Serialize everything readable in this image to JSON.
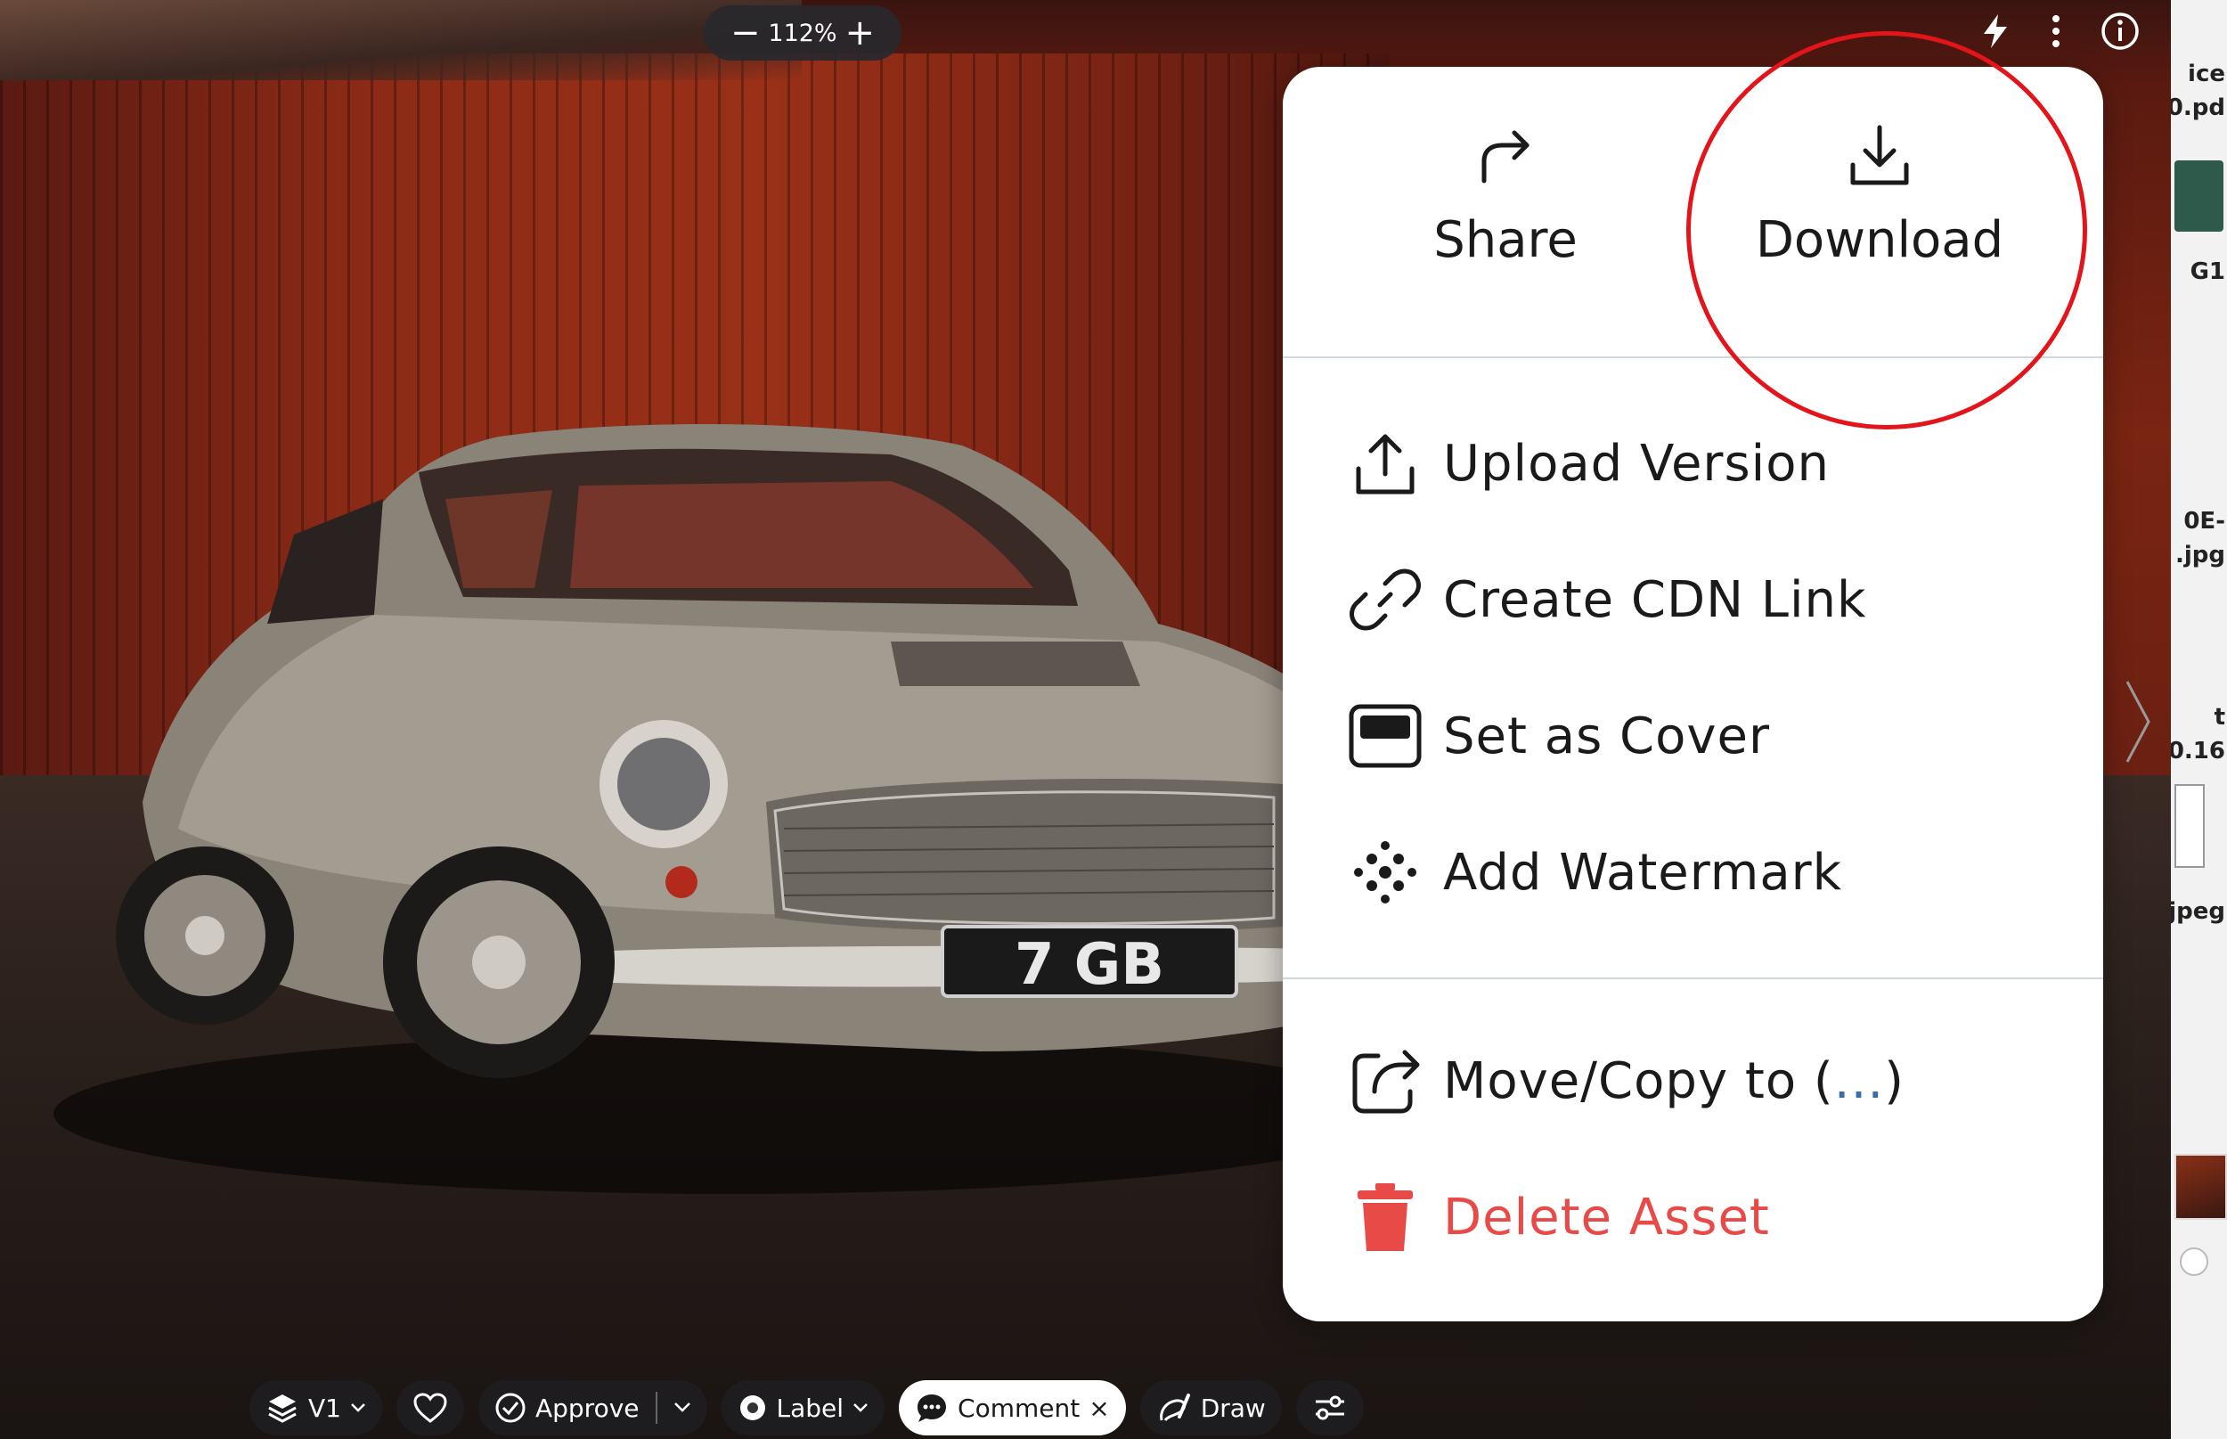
{
  "viewer": {
    "zoom": {
      "minus": "−",
      "level": "112%",
      "plus": "+"
    },
    "plate_text": "7 GB"
  },
  "top_icons": [
    "bolt-icon",
    "more-vertical-icon",
    "info-icon"
  ],
  "file_panel": {
    "labels": [
      "ice",
      "0.pd",
      "G1",
      "0E-",
      ".jpg",
      "t",
      "0.16",
      "jpeg"
    ]
  },
  "menu": {
    "share_label": "Share",
    "download_label": "Download",
    "items": [
      {
        "label": "Upload Version",
        "icon": "upload-icon"
      },
      {
        "label": "Create CDN Link",
        "icon": "link-icon"
      },
      {
        "label": "Set as Cover",
        "icon": "cover-icon"
      },
      {
        "label": "Add Watermark",
        "icon": "watermark-icon"
      }
    ],
    "move_label": "Move/Copy to (",
    "move_dots": "...",
    "move_close": ")",
    "delete_label": "Delete Asset"
  },
  "toolbar": {
    "version": "V1",
    "approve": "Approve",
    "label": "Label",
    "comment": "Comment",
    "comment_close": "×",
    "draw": "Draw"
  },
  "colors": {
    "danger": "#e84a48",
    "highlight_circle": "#e3141a",
    "accent_dots": "#3b6ea8"
  }
}
